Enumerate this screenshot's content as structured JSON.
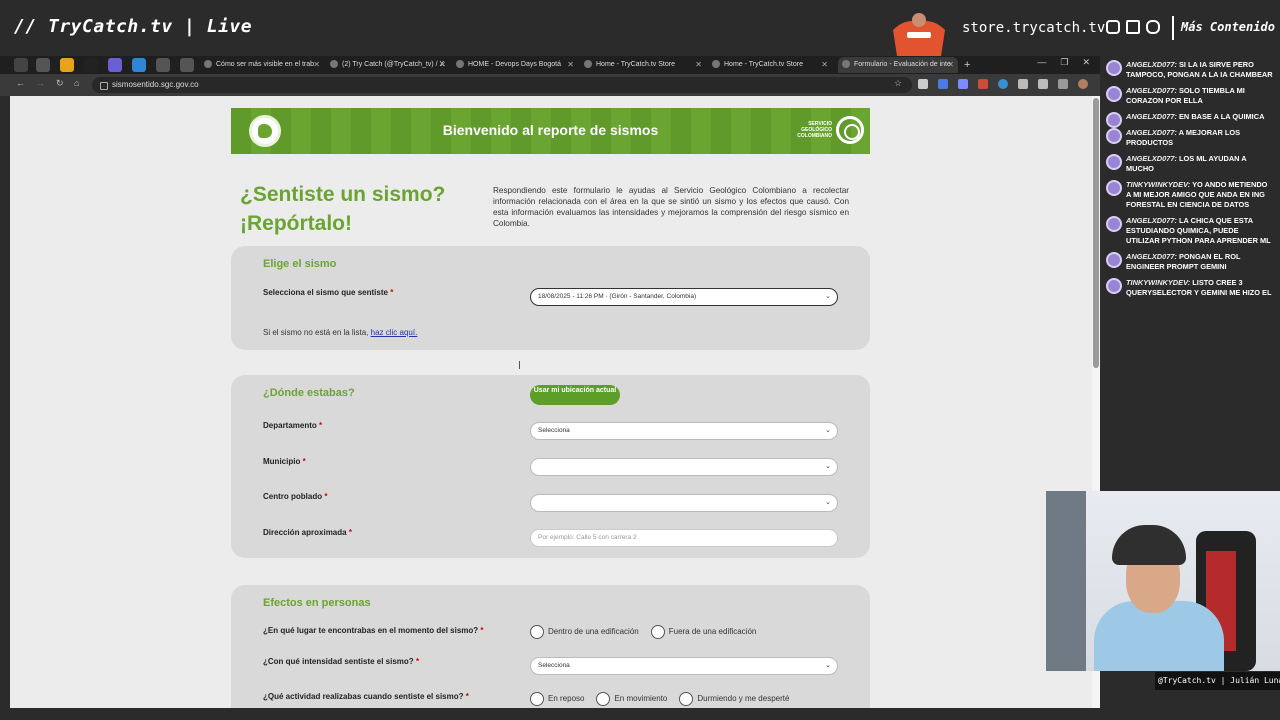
{
  "overlay": {
    "title": "// TryCatch.tv | Live",
    "store_url": "store.trycatch.tv",
    "more_content": "Más Contenido",
    "handle": "@TryCatch.tv | Julián Luna"
  },
  "browser": {
    "tabs": [
      {
        "label": "Cómo ser más visible en el trab"
      },
      {
        "label": "(2) Try Catch (@TryCatch_tv) / X"
      },
      {
        "label": "HOME - Devops Days Bogotá"
      },
      {
        "label": "Home - TryCatch.tv Store"
      },
      {
        "label": "Home - TryCatch.tv Store"
      },
      {
        "label": "Formulario - Evaluación de inte"
      }
    ],
    "url": "sismosentido.sgc.gov.co"
  },
  "page": {
    "banner_title": "Bienvenido al reporte de sismos",
    "logo_text": "SERVICIO GEOLÓGICO COLOMBIANO",
    "hero_title_1": "¿Sentiste un sismo?",
    "hero_title_2": "¡Repórtalo!",
    "hero_text": "Respondiendo este formulario le ayudas al Servicio Geológico Colombiano a recolectar información relacionada con el área en la que se sintió un sismo y los efectos que causó. Con esta información evaluamos las intensidades y mejoramos la comprensión del riesgo sísmico en Colombia.",
    "section1": {
      "heading": "Elige el sismo",
      "label": "Selecciona el sismo que sentiste",
      "selected": "18/08/2025 - 11:26 PM · (Girón - Santander, Colombia)",
      "note": "Si el sismo no está en la lista,",
      "note_link": "haz clic aquí."
    },
    "section2": {
      "heading": "¿Dónde estabas?",
      "location_button": "Usar mi ubicación actual",
      "dept_label": "Departamento",
      "dept_value": "Selecciona",
      "mun_label": "Municipio",
      "mun_value": "",
      "centro_label": "Centro poblado",
      "centro_value": "",
      "dir_label": "Dirección aproximada",
      "dir_placeholder": "Por ejemplo: Calle 5 con carrera 2"
    },
    "section3": {
      "heading": "Efectos en personas",
      "q1_label": "¿En qué lugar te encontrabas en el momento del sismo?",
      "q1_opt1": "Dentro de una edificación",
      "q1_opt2": "Fuera de una edificación",
      "q2_label": "¿Con qué intensidad sentiste el sismo?",
      "q2_value": "Selecciona",
      "q3_label": "¿Qué actividad realizabas cuando sentiste el sismo?",
      "q3_opt1": "En reposo",
      "q3_opt2": "En movimiento",
      "q3_opt3": "Durmiendo y me desperté"
    },
    "required_mark": "*"
  },
  "chat": [
    {
      "user": "ANGELXD077:",
      "text": "SI LA IA SIRVE PERO TAMPOCO, PONGAN A LA IA CHAMBEAR"
    },
    {
      "user": "ANGELXD077:",
      "text": "SOLO TIEMBLA MI CORAZON POR ELLA"
    },
    {
      "user": "ANGELXD077:",
      "text": "EN BASE A LA QUIMICA"
    },
    {
      "user": "ANGELXD077:",
      "text": "A MEJORAR LOS PRODUCTOS"
    },
    {
      "user": "ANGELXD077:",
      "text": "LOS ML AYUDAN A MUCHO"
    },
    {
      "user": "TINKYWINKYDEV:",
      "text": "YO ANDO METIENDO A MI MEJOR AMIGO QUE ANDA EN ING FORESTAL EN CIENCIA DE DATOS"
    },
    {
      "user": "ANGELXD077:",
      "text": "LA CHICA QUE ESTA ESTUDIANDO QUIMICA, PUEDE UTILIZAR PYTHON PARA APRENDER ML"
    },
    {
      "user": "ANGELXD077:",
      "text": "PONGAN EL ROL ENGINEER PROMPT GEMINI"
    },
    {
      "user": "TINKYWINKYDEV:",
      "text": "LISTO CREE 3 QUERYSELECTOR Y GEMINI ME HIZO EL"
    }
  ],
  "colors": {
    "brand_green": "#6aa431",
    "button_green": "#5c9e27",
    "card_bg": "#d9d9d9",
    "page_bg": "#ececec"
  }
}
